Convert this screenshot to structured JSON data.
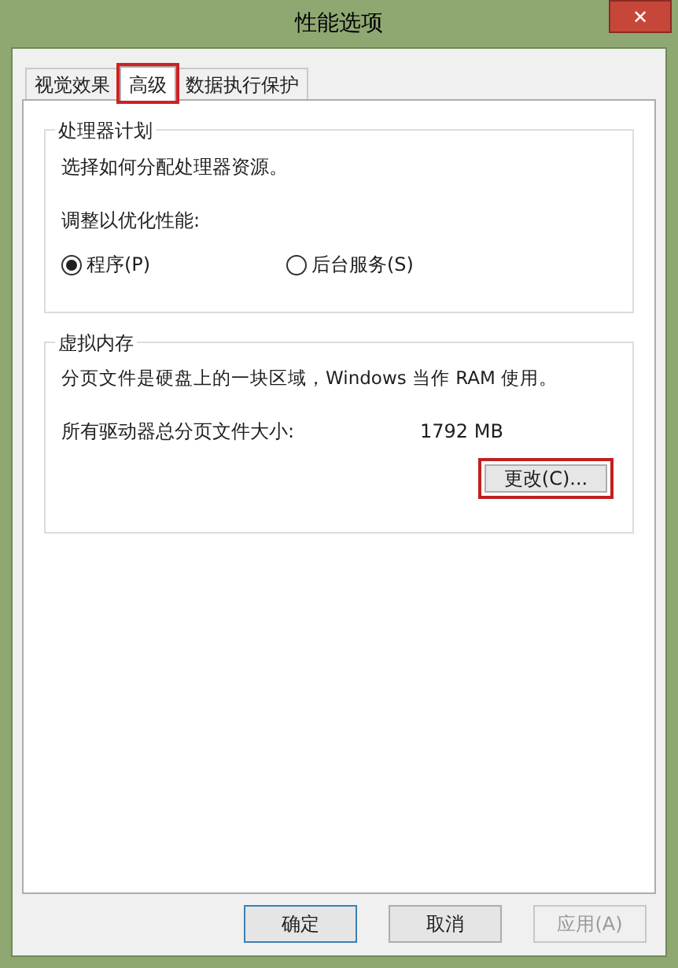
{
  "window": {
    "title": "性能选项",
    "close": "✕"
  },
  "tabs": [
    {
      "label": "视觉效果",
      "selected": false,
      "highlighted": false
    },
    {
      "label": "高级",
      "selected": true,
      "highlighted": true
    },
    {
      "label": "数据执行保护",
      "selected": false,
      "highlighted": false
    }
  ],
  "processor_group": {
    "title": "处理器计划",
    "description": "选择如何分配处理器资源。",
    "prompt": "调整以优化性能:",
    "options": [
      {
        "label": "程序(P)",
        "selected": true
      },
      {
        "label": "后台服务(S)",
        "selected": false
      }
    ]
  },
  "memory_group": {
    "title": "虚拟内存",
    "description": "分页文件是硬盘上的一块区域，Windows 当作 RAM 使用。",
    "size_label": "所有驱动器总分页文件大小:",
    "size_value": "1792 MB",
    "change_button": {
      "label": "更改(C)...",
      "highlighted": true
    }
  },
  "buttons": [
    {
      "label": "确定",
      "disabled": false
    },
    {
      "label": "取消",
      "disabled": false
    },
    {
      "label": "应用(A)",
      "disabled": true
    }
  ]
}
